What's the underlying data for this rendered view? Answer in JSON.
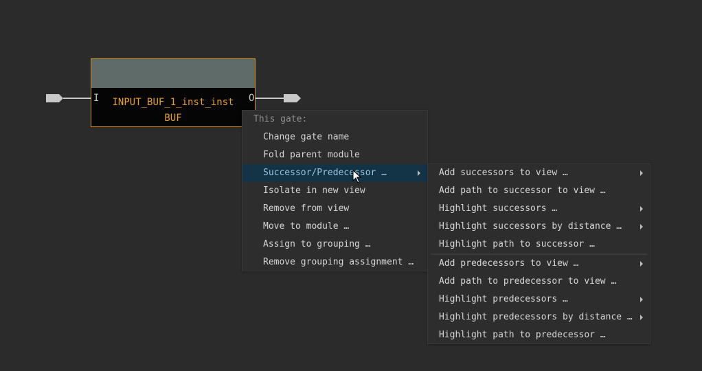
{
  "gate": {
    "name": "INPUT_BUF_1_inst_inst",
    "type": "BUF",
    "input_pin": "I",
    "output_pin": "O",
    "border_color": "#d4901a",
    "text_color": "#e8a020"
  },
  "context_menu": {
    "title": "This gate:",
    "items": [
      {
        "label": "Change gate name"
      },
      {
        "label": "Fold parent module"
      },
      {
        "label": "Successor/Predecessor …",
        "submenu": true,
        "active": true
      },
      {
        "label": "Isolate in new view"
      },
      {
        "label": "Remove from view"
      },
      {
        "label": "Move to module …"
      },
      {
        "label": "Assign to grouping …"
      },
      {
        "label": "Remove grouping assignment …"
      }
    ]
  },
  "submenu": {
    "successors": [
      {
        "label": "Add successors to view …",
        "submenu": true
      },
      {
        "label": "Add path to successor to view …"
      },
      {
        "label": "Highlight successors …",
        "submenu": true
      },
      {
        "label": "Highlight successors by distance …",
        "submenu": true
      },
      {
        "label": "Highlight path to successor …"
      }
    ],
    "predecessors": [
      {
        "label": "Add predecessors to view …",
        "submenu": true
      },
      {
        "label": "Add path to predecessor to view …"
      },
      {
        "label": "Highlight predecessors …",
        "submenu": true
      },
      {
        "label": "Highlight predecessors by distance …",
        "submenu": true
      },
      {
        "label": "Highlight path to predecessor …"
      }
    ]
  },
  "colors": {
    "background": "#2b2b2b",
    "menu_highlight": "#133347",
    "wire": "#c8c8c8"
  }
}
